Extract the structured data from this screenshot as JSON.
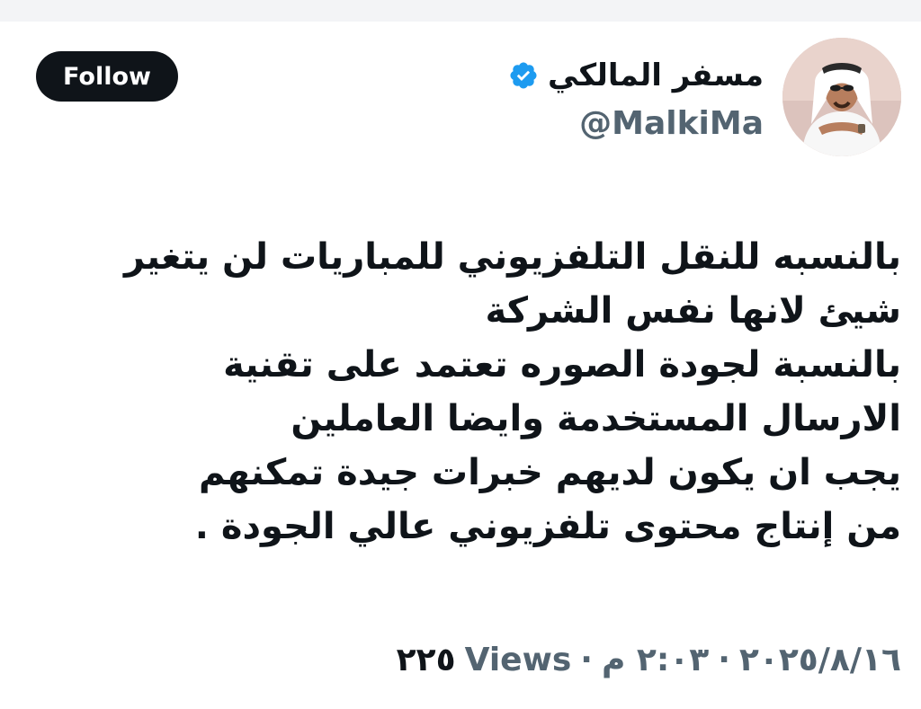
{
  "header": {
    "follow_label": "Follow"
  },
  "author": {
    "display_name": "مسفر المالكي",
    "handle": "@MalkiMa",
    "verified_icon": "verified-badge-icon",
    "verified_color": "#1d9bf0"
  },
  "tweet": {
    "lines": [
      "بالنسبه للنقل التلفزيوني للمباريات لن يتغير",
      "شيئ  لانها نفس الشركة",
      "بالنسبة لجودة  الصوره تعتمد على  تقنية",
      "الارسال المستخدمة وايضا العاملين",
      " يجب ان يكون لديهم خبرات جيدة  تمكنهم",
      "من إنتاج محتوى تلفزيوني عالي الجودة ."
    ]
  },
  "meta": {
    "date": "٢٠٢٥/٨/١٦",
    "time": "٢:٠٣ م",
    "separator": "·",
    "views_count": "٢٢٥",
    "views_label": "Views"
  },
  "colors": {
    "text": "#0f1419",
    "secondary": "#536471",
    "button_bg": "#0f1419",
    "button_text": "#ffffff"
  }
}
